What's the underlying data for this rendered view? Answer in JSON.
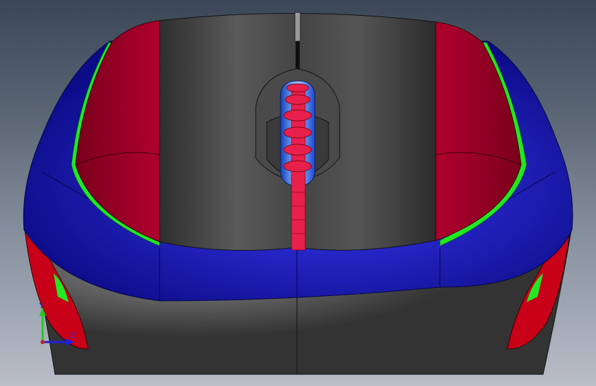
{
  "viewport": {
    "background_top": "#3b4757",
    "background_bottom": "#b9bec8"
  },
  "model": {
    "colors": {
      "body_dark": "#3a3a3a",
      "shell_blue": "#10109a",
      "button_red": "#a0002a",
      "accent_green": "#22e822",
      "wheel_red": "#e8204c",
      "wheel_housing_blue": "#2466e8",
      "rubber_side_red": "#c00018"
    },
    "icon": "mouse-3d-model-icon"
  },
  "triad": {
    "y_label": "Y",
    "z_label": "Z",
    "y_color": "#22c822",
    "z_color": "#2020e0"
  }
}
